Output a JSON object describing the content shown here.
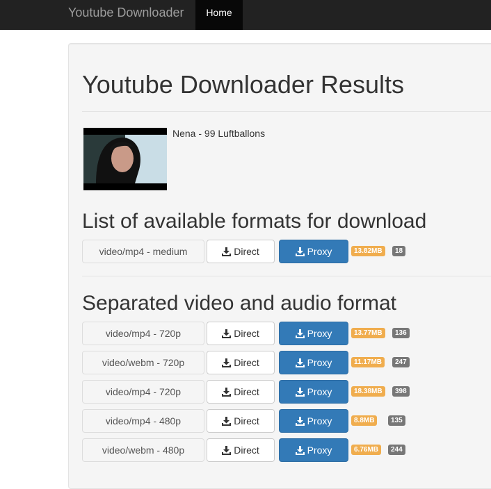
{
  "navbar": {
    "brand": "Youtube Downloader",
    "home": "Home"
  },
  "page": {
    "title": "Youtube Downloader Results"
  },
  "video": {
    "title": "Nena - 99 Luftballons"
  },
  "formats_section": {
    "title": "List of available formats for download",
    "rows": [
      {
        "format": "video/mp4 - medium",
        "direct": "Direct",
        "proxy": "Proxy",
        "size": "13.82MB",
        "itag": "18"
      }
    ]
  },
  "separated_section": {
    "title": "Separated video and audio format",
    "rows": [
      {
        "format": "video/mp4 - 720p",
        "direct": "Direct",
        "proxy": "Proxy",
        "size": "13.77MB",
        "itag": "136"
      },
      {
        "format": "video/webm - 720p",
        "direct": "Direct",
        "proxy": "Proxy",
        "size": "11.17MB",
        "itag": "247"
      },
      {
        "format": "video/mp4 - 720p",
        "direct": "Direct",
        "proxy": "Proxy",
        "size": "18.38MB",
        "itag": "398"
      },
      {
        "format": "video/mp4 - 480p",
        "direct": "Direct",
        "proxy": "Proxy",
        "size": "8.8MB",
        "itag": "135"
      },
      {
        "format": "video/webm - 480p",
        "direct": "Direct",
        "proxy": "Proxy",
        "size": "6.76MB",
        "itag": "244"
      }
    ]
  },
  "colors": {
    "navbar": "#222222",
    "primary": "#337ab7",
    "warning": "#f0ad4e",
    "badge": "#777777"
  },
  "icons": {
    "download": "download-icon"
  }
}
